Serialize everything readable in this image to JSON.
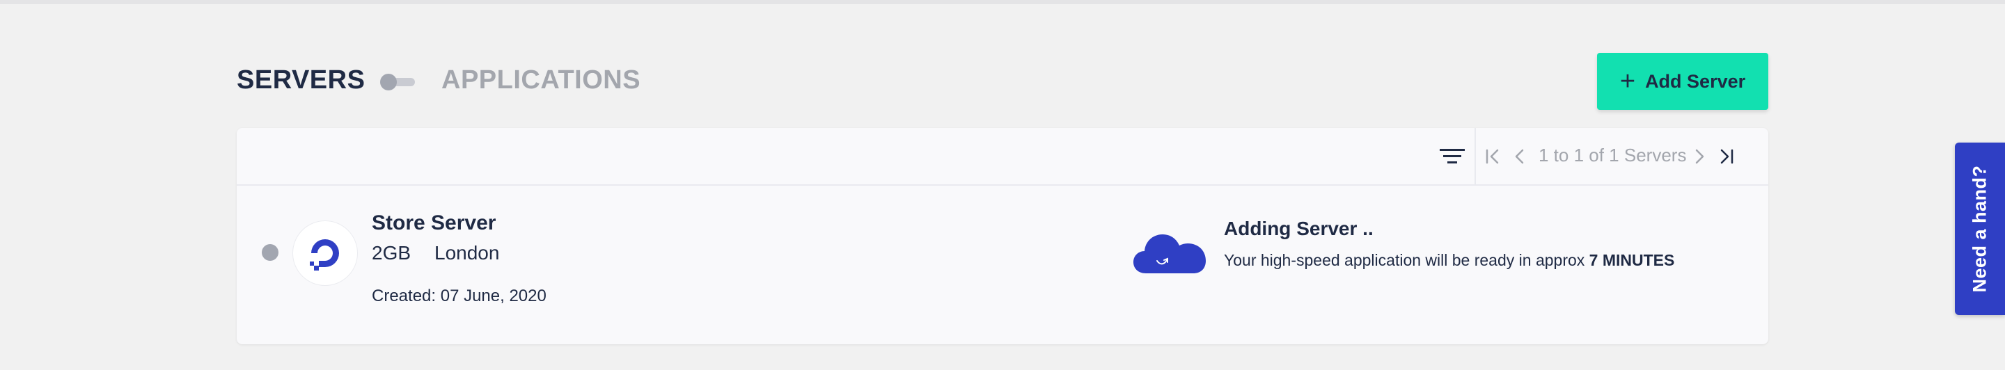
{
  "header": {
    "tabs": [
      {
        "label": "SERVERS",
        "active": true
      },
      {
        "label": "APPLICATIONS",
        "active": false
      }
    ],
    "add_button": {
      "icon": "plus-icon",
      "label": "Add Server"
    }
  },
  "toolbar": {
    "sort_icon": "sort-lines-icon",
    "pagination_text": "1 to 1 of 1 Servers",
    "icons": [
      "first-page-icon",
      "prev-page-icon",
      "next-page-icon",
      "last-page-icon"
    ]
  },
  "servers": [
    {
      "name": "Store Server",
      "size": "2GB",
      "location": "London",
      "created": "Created: 07 June, 2020",
      "provider_icon": "digitalocean-logo-icon",
      "status": {
        "icon": "cloud-icon",
        "title": "Adding Server ..",
        "description": "Your high-speed application will be ready in approx",
        "eta": "7 MINUTES"
      }
    }
  ],
  "help_tab": {
    "label": "Need a hand?"
  },
  "colors": {
    "background": "#f1f1f1",
    "accent": "#12e0b0",
    "brand_blue": "#2f3fc4",
    "text_primary": "#1f2a44",
    "text_muted": "#a3a6ad"
  }
}
